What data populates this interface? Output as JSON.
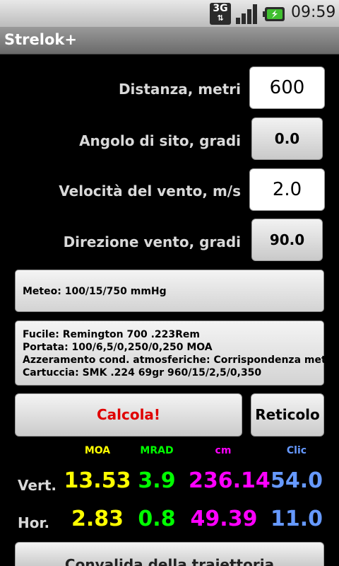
{
  "status_bar": {
    "network": "3G",
    "time": "09:59"
  },
  "app_title": "Strelok+",
  "inputs": [
    {
      "label": "Distanza, metri",
      "value": "600"
    },
    {
      "label": "Angolo di sito, gradi",
      "value": "0.0"
    },
    {
      "label": "Velocità del vento, m/s",
      "value": "2.0"
    },
    {
      "label": "Direzione vento, gradi",
      "value": "90.0"
    }
  ],
  "meteo": "Meteo: 100/15/750 mmHg",
  "rifle_info": [
    "Fucile: Remington 700 .223Rem",
    "Portata: 100/6,5/0,250/0,250 MOA",
    "Azzeramento cond. atmosferiche: Corrispondenza meteo",
    "Cartuccia: SMK .224 69gr 960/15/2,5/0,350"
  ],
  "buttons": {
    "calculate": "Calcola!",
    "reticle": "Reticolo",
    "validate": "Convalida della traiettoria"
  },
  "results": {
    "headers": [
      "MOA",
      "MRAD",
      "cm",
      "Clic"
    ],
    "header_colors": [
      "#ffff00",
      "#00ff00",
      "#ff00ff",
      "#6699ff"
    ],
    "rows": [
      {
        "label": "Vert.",
        "values": [
          "13.53",
          "3.9",
          "236.14",
          "54.0"
        ]
      },
      {
        "label": "Hor.",
        "values": [
          "2.83",
          "0.8",
          "49.39",
          "11.0"
        ]
      }
    ]
  },
  "colors": {
    "calculate_text": "#e00000",
    "accent_green": "#3fbf2f"
  }
}
